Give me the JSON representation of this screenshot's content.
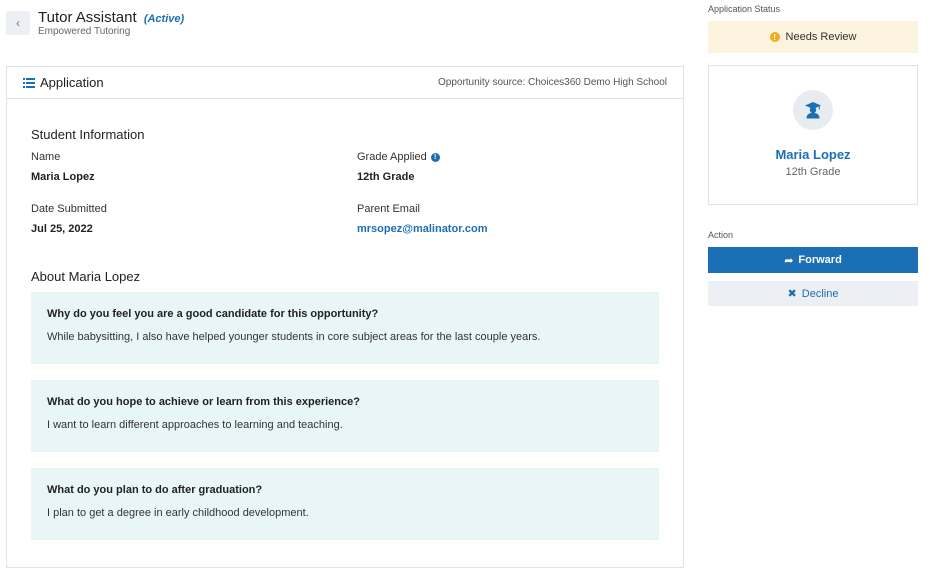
{
  "header": {
    "title": "Tutor Assistant",
    "status_tag": "(Active)",
    "subtitle": "Empowered Tutoring",
    "back_icon": "chevron-left-icon"
  },
  "application": {
    "title": "Application",
    "opportunity_source": "Opportunity source: Choices360 Demo High School",
    "student_info_title": "Student Information",
    "name_label": "Name",
    "name_value": "Maria Lopez",
    "grade_label": "Grade Applied",
    "grade_value": "12th Grade",
    "date_label": "Date Submitted",
    "date_value": "Jul 25, 2022",
    "email_label": "Parent Email",
    "email_value": "mrsopez@malinator.com",
    "about_title": "About Maria Lopez",
    "qa": [
      {
        "question": "Why do you feel you are a good candidate for this opportunity?",
        "answer": "While babysitting, I also have helped younger students in core subject areas for the last couple years."
      },
      {
        "question": "What do you hope to achieve or learn from this experience?",
        "answer": "I want to learn different approaches to learning and teaching."
      },
      {
        "question": "What do you plan to do after graduation?",
        "answer": "I plan to get a degree in early childhood development."
      }
    ]
  },
  "status": {
    "label": "Application Status",
    "value": "Needs Review"
  },
  "profile": {
    "name": "Maria Lopez",
    "grade": "12th Grade"
  },
  "actions": {
    "label": "Action",
    "forward": "Forward",
    "decline": "Decline"
  },
  "colors": {
    "accent": "#1b6fb5",
    "status_bg": "#fcf3df",
    "qa_bg": "#e9f6f7"
  }
}
